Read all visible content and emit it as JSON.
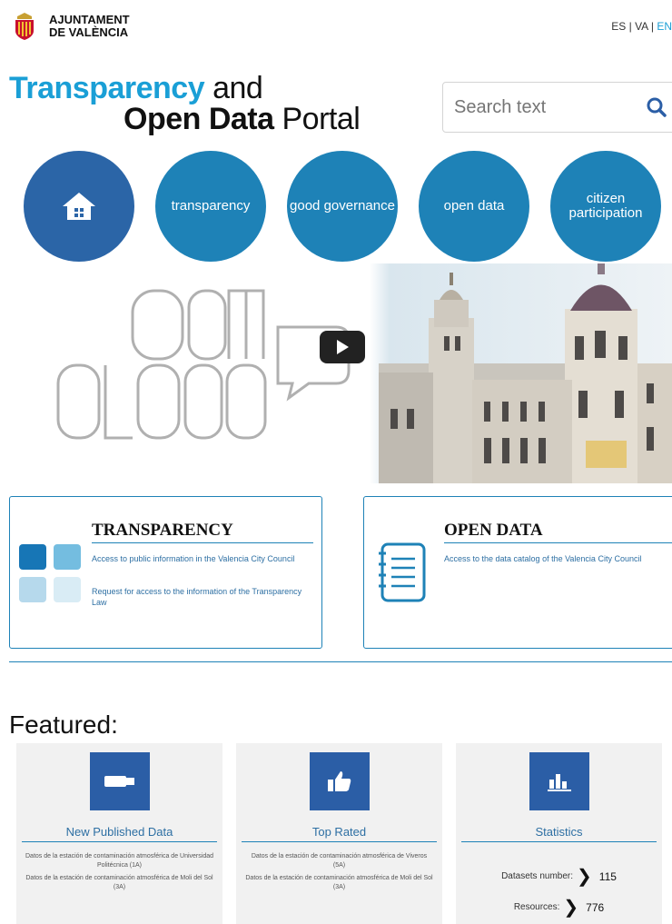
{
  "header": {
    "org_line1": "AJUNTAMENT",
    "org_line2": "DE VALÈNCIA",
    "lang_es": "ES",
    "lang_va": "VA",
    "lang_en": "EN",
    "lang_sep": " | "
  },
  "portal": {
    "title_blue": "Transparency",
    "title_and": " and",
    "title_bold": "Open Data",
    "title_portal": " Portal"
  },
  "search": {
    "placeholder": "Search text"
  },
  "nav": {
    "transparency": "transparency",
    "good_governance": "good governance",
    "open_data": "open data",
    "citizen_participation": "citizen participation"
  },
  "video": {
    "logo_line1": "som",
    "logo_line2": "clars"
  },
  "boxes": {
    "transparency": {
      "title": "TRANSPARENCY",
      "link1": "Access to public information in the Valencia City Council",
      "link2": "Request for access to the information of the Transparency Law"
    },
    "open_data": {
      "title": "OPEN DATA",
      "link1": "Access to the data catalog of the Valencia City Council"
    }
  },
  "featured": {
    "title": "Featured:",
    "new_published": {
      "title": "New Published Data",
      "items": [
        "Datos de la estación de contaminación atmosférica de Universidad Politécnica (1A)",
        "Datos de la estación de contaminación atmosférica de Moli del Sol (3A)"
      ]
    },
    "top_rated": {
      "title": "Top Rated",
      "items": [
        "Datos de la estación de contaminación atmosférica de Viveros (5A)",
        "Datos de la estación de contaminación atmosférica de Moli del Sol (3A)"
      ]
    },
    "statistics": {
      "title": "Statistics",
      "datasets_label": "Datasets number:",
      "datasets_value": "115",
      "resources_label": "Resources:",
      "resources_value": "776"
    }
  },
  "colors": {
    "accent_blue": "#1a9fd6",
    "circle_blue": "#1e82b7",
    "home_blue": "#2b65a7",
    "card_icon_blue": "#2b5ea6"
  },
  "icons": [
    "city-crest-icon",
    "search-icon",
    "home-icon",
    "play-icon",
    "tiles-icon",
    "notebook-icon",
    "usb-icon",
    "thumbs-up-icon",
    "bar-chart-icon"
  ]
}
